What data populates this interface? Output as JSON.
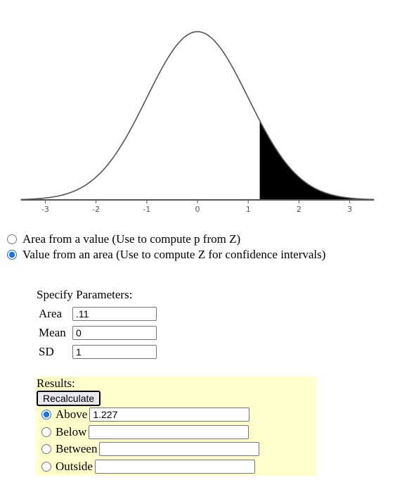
{
  "chart_data": {
    "type": "area",
    "title": "",
    "distribution": "normal",
    "mean": 0,
    "sd": 1,
    "xlim": [
      -3.5,
      3.5
    ],
    "x_ticks": [
      -3,
      -2,
      -1,
      0,
      1,
      2,
      3
    ],
    "x_tick_labels": [
      "-3",
      "-2",
      "-1",
      "0",
      "1",
      "2",
      "3"
    ],
    "shaded_region": {
      "type": "above",
      "from": 1.227,
      "to": 3.5
    },
    "curve_color": "#555555",
    "fill_color": "#000000"
  },
  "mode_options": [
    {
      "label": "Area from a value (Use to compute p from Z)",
      "checked": false
    },
    {
      "label": "Value from an area (Use to compute Z for confidence intervals)",
      "checked": true
    }
  ],
  "params": {
    "title": "Specify Parameters:",
    "area_label": "Area",
    "area_value": ".11",
    "mean_label": "Mean",
    "mean_value": "0",
    "sd_label": "SD",
    "sd_value": "1"
  },
  "results": {
    "title": "Results:",
    "recalculate_label": "Recalculate",
    "background": "#ffffcc",
    "options": [
      {
        "label": "Above",
        "value": "1.227",
        "checked": true
      },
      {
        "label": "Below",
        "value": "",
        "checked": false
      },
      {
        "label": "Between",
        "value": "",
        "checked": false
      },
      {
        "label": "Outside",
        "value": "",
        "checked": false
      }
    ]
  }
}
